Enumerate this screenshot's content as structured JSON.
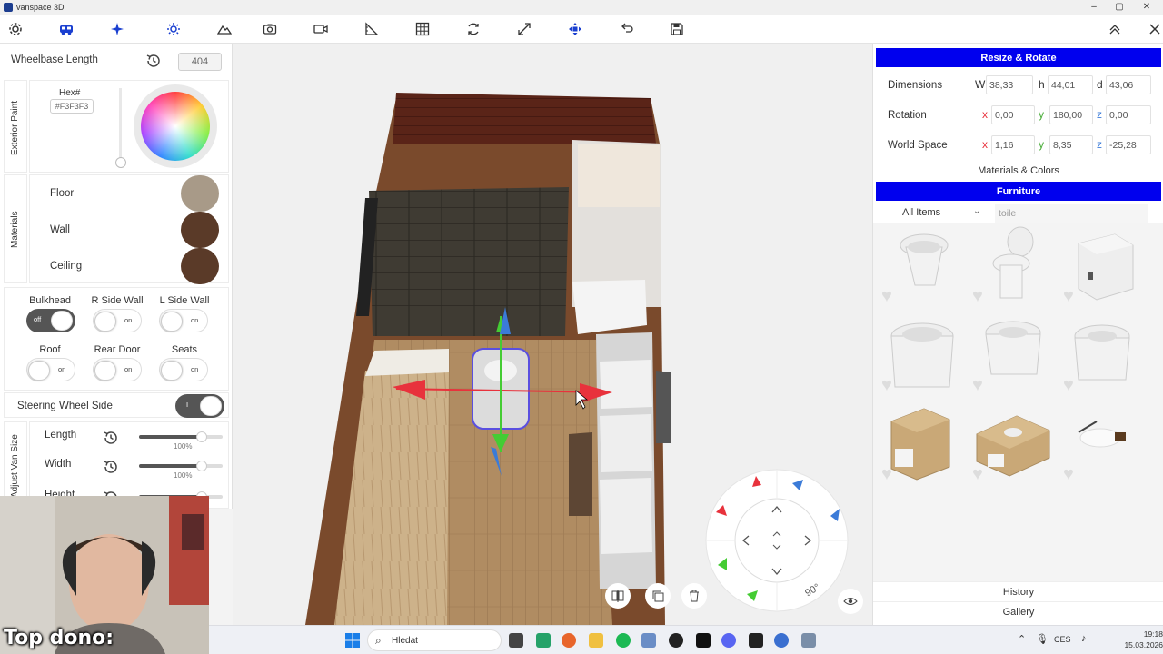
{
  "window": {
    "title": "vanspace 3D",
    "minimize": "–",
    "maximize": "▢",
    "close": "✕"
  },
  "toolbar": {
    "icons": [
      "gear-icon",
      "van-icon",
      "sparkle-icon",
      "sun-icon",
      "mountain-icon",
      "camera-icon",
      "video-icon",
      "ruler-icon",
      "grid-icon",
      "rotate-icon",
      "expand-icon",
      "move-icon",
      "undo-icon",
      "save-icon",
      "collapse-up-icon",
      "close-icon"
    ]
  },
  "left_panel": {
    "wheelbase": {
      "label": "Wheelbase Length",
      "value": "404"
    },
    "exterior_paint": {
      "section_label": "Exterior Paint",
      "hex_label": "Hex#",
      "hex_value": "#F3F3F3"
    },
    "materials": {
      "section_label": "Materials",
      "items": [
        {
          "label": "Floor",
          "color": "#a89a88"
        },
        {
          "label": "Wall",
          "color": "#5a3a28"
        },
        {
          "label": "Ceiling",
          "color": "#5a3a28"
        }
      ]
    },
    "toggles": [
      {
        "label": "Bulkhead",
        "state": "off"
      },
      {
        "label": "R Side Wall",
        "state": "on"
      },
      {
        "label": "L Side Wall",
        "state": "on"
      },
      {
        "label": "Roof",
        "state": "on"
      },
      {
        "label": "Rear Door",
        "state": "on"
      },
      {
        "label": "Seats",
        "state": "on"
      }
    ],
    "steering": {
      "label": "Steering Wheel Side",
      "state": "I"
    },
    "van_size": {
      "section_label": "Adjust Van Size",
      "sliders": [
        {
          "label": "Length",
          "value": "100%",
          "fraction": 0.75
        },
        {
          "label": "Width",
          "value": "100%",
          "fraction": 0.75
        },
        {
          "label": "Height",
          "value": "",
          "fraction": 0.75
        }
      ]
    }
  },
  "right_panel": {
    "resize_header": "Resize & Rotate",
    "dimensions": {
      "label": "Dimensions",
      "w_label": "W",
      "w": "38,33",
      "h_label": "h",
      "h": "44,01",
      "d_label": "d",
      "d": "43,06"
    },
    "rotation": {
      "label": "Rotation",
      "x": "0,00",
      "y": "180,00",
      "z": "0,00"
    },
    "world_space": {
      "label": "World Space",
      "x": "1,16",
      "y": "8,35",
      "z": "-25,28"
    },
    "axis_labels": {
      "x": "x",
      "y": "y",
      "z": "z"
    },
    "materials_colors": "Materials & Colors",
    "furniture_header": "Furniture",
    "filter": {
      "selected": "All Items",
      "search_value": "toile"
    },
    "history": "History",
    "gallery": "Gallery"
  },
  "viewport": {
    "rotate_label": "90°"
  },
  "taskbar": {
    "search_placeholder": "Hledat",
    "language": "CES",
    "time": "19:18",
    "date": "15.03.2026"
  },
  "overlay": {
    "dono_text": "Top dono:"
  },
  "colors": {
    "accent_blue": "#0000ee",
    "gizmo_red": "#e8323c",
    "gizmo_green": "#44cc33",
    "gizmo_blue": "#3b7bd8"
  }
}
